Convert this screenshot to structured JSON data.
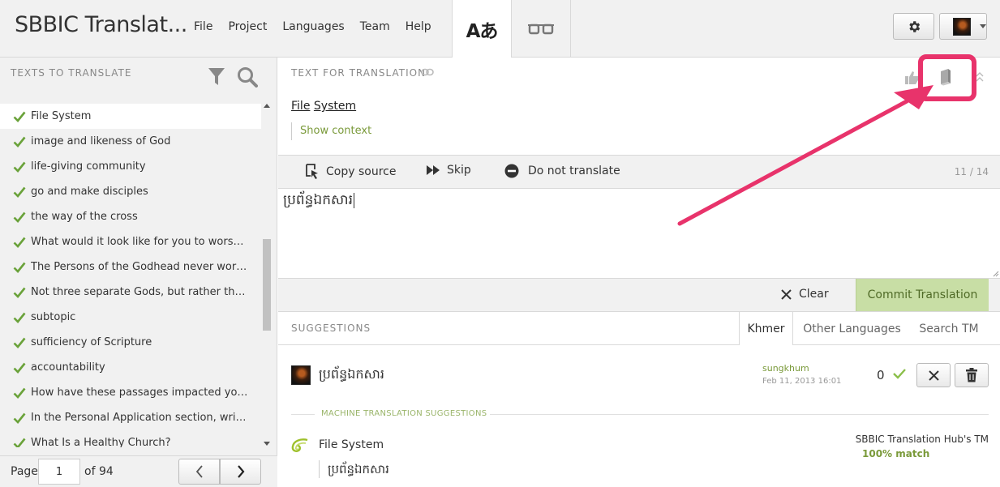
{
  "header": {
    "app_title": "SBBIC Translat...",
    "menu": [
      "File",
      "Project",
      "Languages",
      "Team",
      "Help"
    ],
    "mode_translate_glyph": "Aあ"
  },
  "left_panel": {
    "title": "TEXTS TO TRANSLATE",
    "items": [
      "File System",
      "image and likeness of God",
      "life-giving community",
      "go and make disciples",
      "the way of the cross",
      "What would it look like for you to worship ...",
      "The Persons of the Godhead never work se...",
      "Not three separate Gods, but rather three ...",
      "subtopic",
      "sufficiency of Scripture",
      "accountability",
      "How have these passages impacted your lif...",
      "In the Personal Application section, write o...",
      "What Is a Healthy Church?"
    ],
    "selected_index": 0,
    "pager": {
      "page_label": "Page",
      "page_value": "1",
      "of_label": "of 94"
    }
  },
  "source": {
    "title": "TEXT FOR TRANSLATION",
    "words": [
      "File",
      "System"
    ],
    "show_context": "Show context"
  },
  "toolbar": {
    "copy_source": "Copy source",
    "skip": "Skip",
    "do_not_translate": "Do not translate",
    "counter": "11 / 14"
  },
  "editor": {
    "value": "ប្រព័ន្ធឯកសារ"
  },
  "actions": {
    "clear": "Clear",
    "commit": "Commit Translation"
  },
  "suggestions": {
    "title": "SUGGESTIONS",
    "tabs": [
      "Khmer",
      "Other Languages",
      "Search TM"
    ],
    "active_tab": "Khmer",
    "item": {
      "text": "ប្រព័ន្ធឯកសារ",
      "author": "sungkhum",
      "date": "Feb 11, 2013 16:01",
      "votes": "0"
    },
    "machine_label": "MACHINE TRANSLATION SUGGESTIONS",
    "machine": {
      "source": "File System",
      "target": "ប្រព័ន្ធឯកសារ",
      "origin": "SBBIC Translation Hub's TM",
      "match": "100% match"
    }
  },
  "colors": {
    "accent_green": "#7a9a3a",
    "commit_bg": "#c8dea5",
    "annotation": "#e8336b"
  }
}
